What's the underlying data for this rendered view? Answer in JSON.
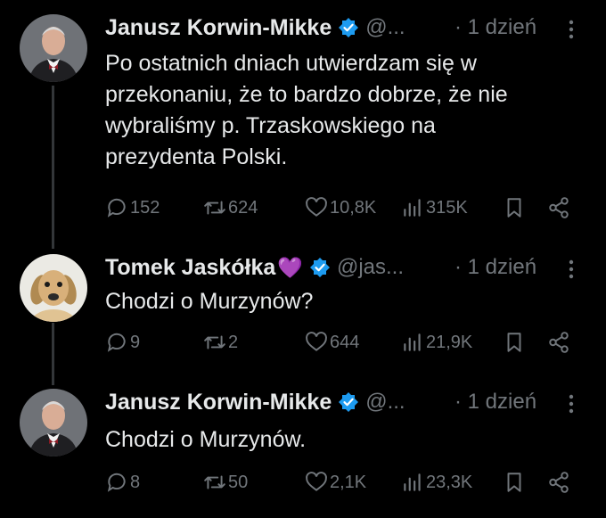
{
  "tweets": [
    {
      "name": "Janusz Korwin-Mikke",
      "emoji": "",
      "handle": "@...",
      "time": "· 1 dzień",
      "text_lines": [
        "Po ostatnich dniach utwierdzam się w",
        "przekonaniu, że to bardzo dobrze, że nie",
        "wybraliśmy p. Trzaskowskiego na",
        "prezydenta Polski."
      ],
      "replies": "152",
      "retweets": "624",
      "likes": "10,8K",
      "views": "315K"
    },
    {
      "name": "Tomek Jaskółka",
      "emoji": "💜",
      "handle": "@jas...",
      "time": "· 1 dzień",
      "text_lines": [
        "Chodzi o Murzynów?"
      ],
      "replies": "9",
      "retweets": "2",
      "likes": "644",
      "views": "21,9K"
    },
    {
      "name": "Janusz Korwin-Mikke",
      "emoji": "",
      "handle": "@...",
      "time": "· 1 dzień",
      "text_lines": [
        "Chodzi o Murzynów."
      ],
      "replies": "8",
      "retweets": "50",
      "likes": "2,1K",
      "views": "23,3K"
    }
  ],
  "colors": {
    "background": "#000000",
    "text": "#e7e9ea",
    "muted": "#71767b",
    "verified": "#1d9bf0"
  }
}
